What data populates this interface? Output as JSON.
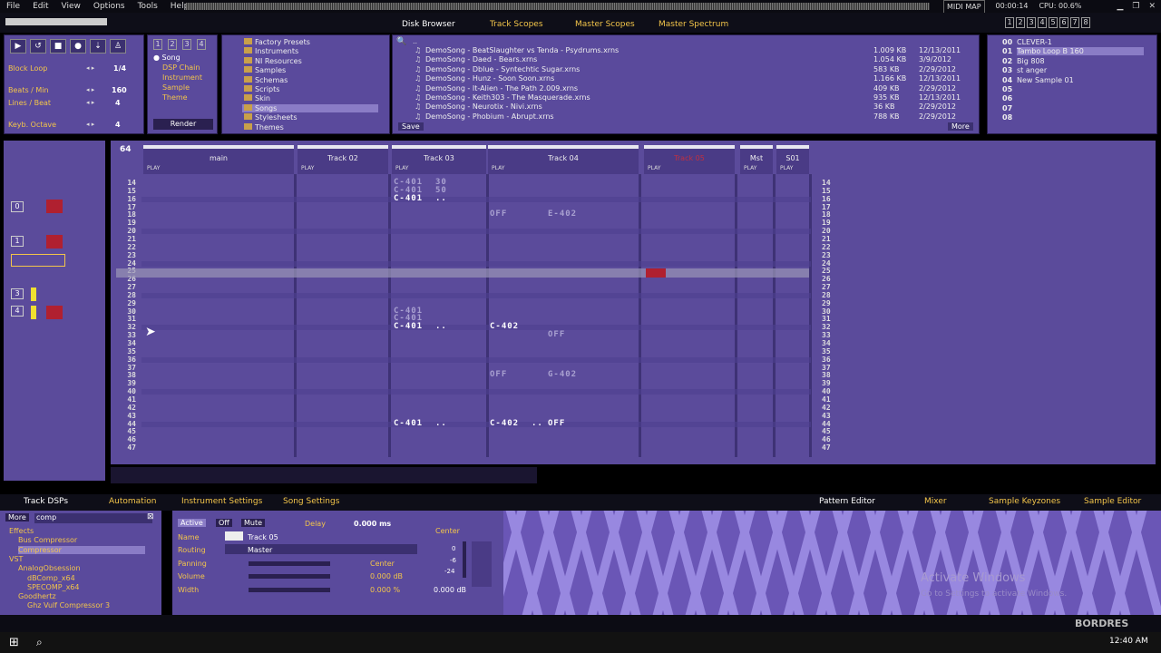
{
  "menu": [
    "File",
    "Edit",
    "View",
    "Options",
    "Tools",
    "Help"
  ],
  "topright": {
    "midi_map": "MIDI MAP",
    "time": "00:00:14",
    "cpu": "CPU: 00.6%"
  },
  "top_tabs": [
    "Disk Browser",
    "Track Scopes",
    "Master Scopes",
    "Master Spectrum"
  ],
  "view_numbers": [
    "1",
    "2",
    "3",
    "4",
    "5",
    "6",
    "7",
    "8"
  ],
  "transport": {
    "block_loop": "Block Loop",
    "block_val": "1/4",
    "bpm_label": "Beats / Min",
    "bpm": "160",
    "lpb_label": "Lines / Beat",
    "lpb": "4",
    "octave_label": "Keyb. Octave",
    "octave": "4"
  },
  "browser_tree": {
    "radios": [
      "Song",
      "DSP Chain",
      "Instrument",
      "Sample",
      "Theme"
    ],
    "render": "Render",
    "slots": [
      "1",
      "2",
      "3",
      "4"
    ]
  },
  "folders": [
    "Factory Presets",
    "Instruments",
    "NI Resources",
    "Samples",
    "Schemas",
    "Scripts",
    "Skin",
    "Songs",
    "Stylesheets",
    "Themes"
  ],
  "save_label": "Save",
  "more_label": "More",
  "files": [
    {
      "name": "DemoSong - BeatSlaughter vs Tenda - Psydrums.xrns",
      "size": "1.009 KB",
      "date": "12/13/2011"
    },
    {
      "name": "DemoSong - Daed - Bears.xrns",
      "size": "1.054 KB",
      "date": "3/9/2012"
    },
    {
      "name": "DemoSong - Dblue - Syntechtic Sugar.xrns",
      "size": "583 KB",
      "date": "2/29/2012"
    },
    {
      "name": "DemoSong - Hunz - Soon Soon.xrns",
      "size": "1.166 KB",
      "date": "12/13/2011"
    },
    {
      "name": "DemoSong - It-Alien - The Path 2.009.xrns",
      "size": "409 KB",
      "date": "2/29/2012"
    },
    {
      "name": "DemoSong - Keith303 - The Masquerade.xrns",
      "size": "935 KB",
      "date": "12/13/2011"
    },
    {
      "name": "DemoSong - Neurotix - Nivi.xrns",
      "size": "36 KB",
      "date": "2/29/2012"
    },
    {
      "name": "DemoSong - Phobium - Abrupt.xrns",
      "size": "788 KB",
      "date": "2/29/2012"
    }
  ],
  "instruments": [
    {
      "idx": "00",
      "name": "CLEVER-1"
    },
    {
      "idx": "01",
      "name": "Tambo Loop B 160"
    },
    {
      "idx": "02",
      "name": "Big 808"
    },
    {
      "idx": "03",
      "name": "st anger"
    },
    {
      "idx": "04",
      "name": "New Sample 01"
    },
    {
      "idx": "05",
      "name": ""
    },
    {
      "idx": "06",
      "name": ""
    },
    {
      "idx": "07",
      "name": ""
    },
    {
      "idx": "08",
      "name": ""
    }
  ],
  "pattern": {
    "length": "64",
    "tracks": [
      {
        "name": "main"
      },
      {
        "name": "Track 02"
      },
      {
        "name": "Track 03"
      },
      {
        "name": "Track 04"
      },
      {
        "name": "Track 05"
      },
      {
        "name": "Mst"
      },
      {
        "name": "S01"
      }
    ],
    "play": "PLAY",
    "lines": [
      "14",
      "15",
      "16",
      "17",
      "18",
      "19",
      "20",
      "21",
      "22",
      "23",
      "24",
      "25",
      "26",
      "27",
      "28",
      "29",
      "30",
      "31",
      "32",
      "33",
      "34",
      "35",
      "36",
      "37",
      "38",
      "39",
      "40",
      "41",
      "42",
      "43",
      "44",
      "45",
      "46",
      "47"
    ],
    "notes": [
      {
        "t": "C-401",
        "v": "30",
        "line": "14",
        "col": "t3",
        "dim": true
      },
      {
        "t": "C-401",
        "v": "50",
        "line": "15",
        "col": "t3",
        "dim": true
      },
      {
        "t": "C-401",
        "v": "..",
        "line": "16",
        "col": "t3"
      },
      {
        "t": "OFF",
        "v": "",
        "line": "18",
        "col": "t4a",
        "dim": true
      },
      {
        "t": "E-402",
        "v": "",
        "line": "18",
        "col": "t4b",
        "dim": true
      },
      {
        "t": "C-401",
        "v": "",
        "line": "30",
        "col": "t3",
        "dim": true
      },
      {
        "t": "C-401",
        "v": "",
        "line": "31",
        "col": "t3",
        "dim": true
      },
      {
        "t": "C-401",
        "v": "..",
        "line": "32",
        "col": "t3"
      },
      {
        "t": "C-402",
        "v": "",
        "line": "32",
        "col": "t4a"
      },
      {
        "t": "OFF",
        "v": "",
        "line": "33",
        "col": "t4b",
        "dim": true
      },
      {
        "t": "OFF",
        "v": "",
        "line": "38",
        "col": "t4a",
        "dim": true
      },
      {
        "t": "G-402",
        "v": "",
        "line": "38",
        "col": "t4b",
        "dim": true
      },
      {
        "t": "C-401",
        "v": "..",
        "line": "44",
        "col": "t3"
      },
      {
        "t": "C-402",
        "v": "..",
        "line": "44",
        "col": "t4a"
      },
      {
        "t": "OFF",
        "v": "",
        "line": "44",
        "col": "t4b"
      }
    ],
    "current_line": "25"
  },
  "bottom_tabs_left": [
    "Track DSPs",
    "Automation",
    "Instrument Settings",
    "Song Settings"
  ],
  "bottom_tabs_right": [
    "Pattern Editor",
    "Mixer",
    "Sample Keyzones",
    "Sample Editor"
  ],
  "dsp": {
    "more": "More",
    "search": "comp",
    "tree": [
      {
        "label": "Effects",
        "level": 0
      },
      {
        "label": "Bus Compressor",
        "level": 1
      },
      {
        "label": "Compressor",
        "level": 1,
        "selected": true
      },
      {
        "label": "VST",
        "level": 0
      },
      {
        "label": "AnalogObsession",
        "level": 1
      },
      {
        "label": "dBComp_x64",
        "level": 2
      },
      {
        "label": "SPECOMP_x64",
        "level": 2
      },
      {
        "label": "Goodhertz",
        "level": 1
      },
      {
        "label": "Ghz Vulf Compressor 3",
        "level": 2
      }
    ]
  },
  "track_settings": {
    "active": "Active",
    "off": "Off",
    "mute": "Mute",
    "delay": "Delay",
    "delay_val": "0.000 ms",
    "name_label": "Name",
    "name_val": "Track 05",
    "routing_label": "Routing",
    "routing_val": "Master",
    "pan_label": "Panning",
    "pan_val": "Center",
    "vol_label": "Volume",
    "vol_val": "0.000 dB",
    "width_label": "Width",
    "width_val": "0.000 %"
  },
  "vu": {
    "center": "Center",
    "m0": "0",
    "m6": "-6",
    "m24": "-24",
    "db": "0.000 dB"
  },
  "watermark": {
    "line1": "Activate Windows",
    "line2": "Go to Settings to activate Windows."
  },
  "logo": "BORDRES",
  "clock": "12:40 AM"
}
